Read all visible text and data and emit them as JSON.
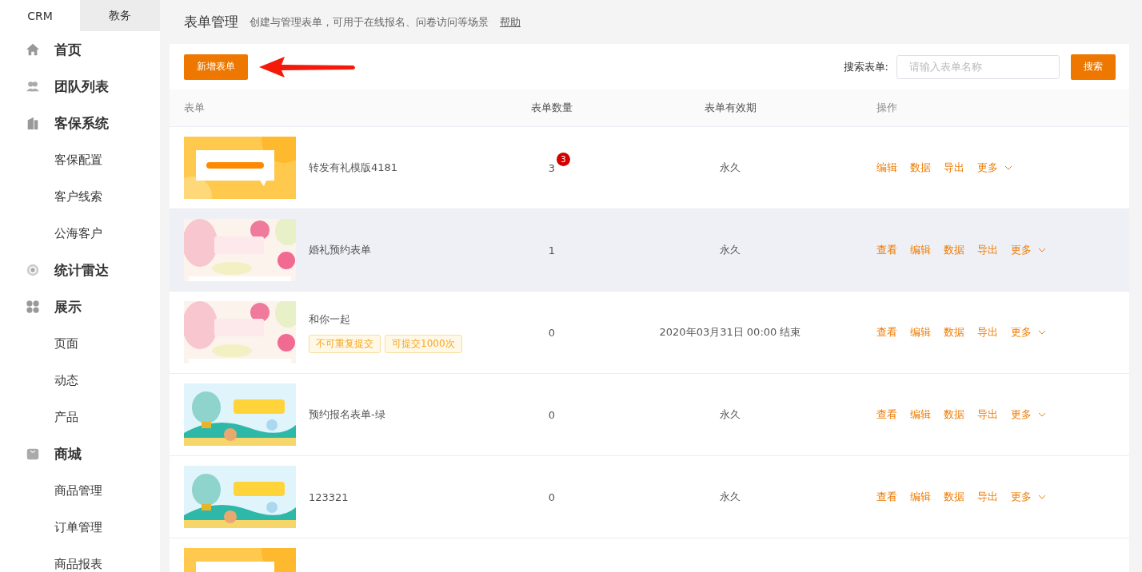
{
  "sidebar": {
    "tabs": [
      {
        "label": "CRM",
        "selected": true
      },
      {
        "label": "教务",
        "selected": false
      }
    ],
    "items": [
      {
        "label": "首页"
      },
      {
        "label": "团队列表"
      },
      {
        "label": "客保系统",
        "children": [
          {
            "label": "客保配置"
          },
          {
            "label": "客户线索"
          },
          {
            "label": "公海客户"
          }
        ]
      },
      {
        "label": "统计雷达"
      },
      {
        "label": "展示",
        "children": [
          {
            "label": "页面"
          },
          {
            "label": "动态"
          },
          {
            "label": "产品"
          }
        ]
      },
      {
        "label": "商城",
        "children": [
          {
            "label": "商品管理"
          },
          {
            "label": "订单管理"
          },
          {
            "label": "商品报表"
          }
        ]
      }
    ]
  },
  "header": {
    "title": "表单管理",
    "description": "创建与管理表单，可用于在线报名、问卷访问等场景",
    "help_link": "帮助"
  },
  "toolbar": {
    "add_button": "新增表单",
    "search_label": "搜索表单:",
    "search_placeholder": "请输入表单名称",
    "search_button": "搜索"
  },
  "table": {
    "columns": [
      "表单",
      "表单数量",
      "表单有效期",
      "操作"
    ],
    "rows": [
      {
        "name": "转发有礼模版4181",
        "count": "3",
        "badge": "3",
        "validity": "永久",
        "selected": false,
        "actions": [
          "编辑",
          "数据",
          "导出",
          "更多"
        ]
      },
      {
        "name": "婚礼预约表单",
        "count": "1",
        "validity": "永久",
        "selected": true,
        "actions": [
          "查看",
          "编辑",
          "数据",
          "导出",
          "更多"
        ]
      },
      {
        "name": "和你一起",
        "tags": [
          "不可重复提交",
          "可提交1000次"
        ],
        "count": "0",
        "validity": "2020年03月31日 00:00 结束",
        "selected": false,
        "actions": [
          "查看",
          "编辑",
          "数据",
          "导出",
          "更多"
        ]
      },
      {
        "name": "预约报名表单-绿",
        "count": "0",
        "validity": "永久",
        "selected": false,
        "actions": [
          "查看",
          "编辑",
          "数据",
          "导出",
          "更多"
        ]
      },
      {
        "name": "123321",
        "count": "0",
        "validity": "永久",
        "selected": false,
        "actions": [
          "查看",
          "编辑",
          "数据",
          "导出",
          "更多"
        ]
      },
      {
        "selected": false
      }
    ]
  }
}
